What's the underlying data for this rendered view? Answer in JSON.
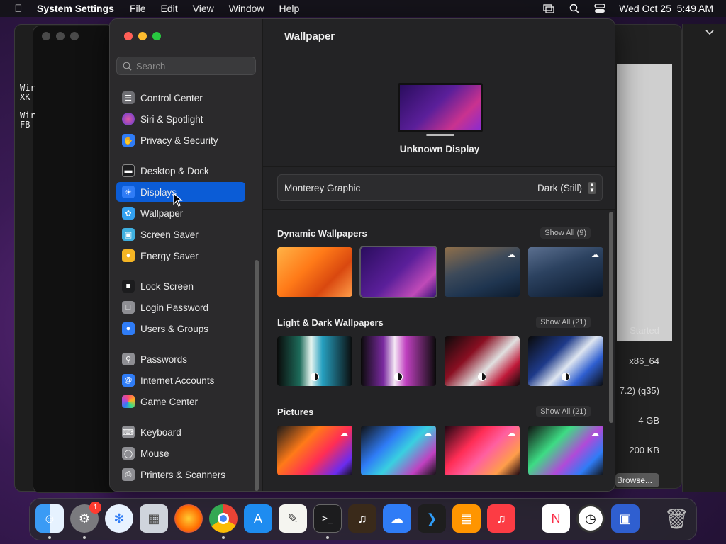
{
  "menubar": {
    "app_name": "System Settings",
    "menus": [
      "File",
      "Edit",
      "View",
      "Window",
      "Help"
    ],
    "clock": "Wed Oct 25  5:49 AM"
  },
  "background": {
    "terminal_text": "Wir\nXK\n\nWir\nFB",
    "right_values": [
      "Started",
      "x86_64",
      "7.2) (q35)",
      "4 GB",
      "200 KB"
    ],
    "browse_label": "Browse..."
  },
  "sidebar": {
    "search_placeholder": "Search",
    "items": [
      {
        "label": "Control Center",
        "icon": "control-center-icon",
        "color": "#6e6e73"
      },
      {
        "label": "Siri & Spotlight",
        "icon": "siri-icon",
        "color": "#b04ad8"
      },
      {
        "label": "Privacy & Security",
        "icon": "hand-icon",
        "color": "#2f7cf6"
      },
      {
        "label": "Desktop & Dock",
        "icon": "desktop-icon",
        "color": "#1c1c1e"
      },
      {
        "label": "Displays",
        "icon": "displays-icon",
        "color": "#2f7cf6"
      },
      {
        "label": "Wallpaper",
        "icon": "wallpaper-icon",
        "color": "#33a1f0"
      },
      {
        "label": "Screen Saver",
        "icon": "screen-saver-icon",
        "color": "#3fb0e0"
      },
      {
        "label": "Energy Saver",
        "icon": "energy-icon",
        "color": "#f5b524"
      },
      {
        "label": "Lock Screen",
        "icon": "lock-icon",
        "color": "#1c1c1e"
      },
      {
        "label": "Login Password",
        "icon": "login-password-icon",
        "color": "#8e8e93"
      },
      {
        "label": "Users & Groups",
        "icon": "users-icon",
        "color": "#2f7cf6"
      },
      {
        "label": "Passwords",
        "icon": "key-icon",
        "color": "#8e8e93"
      },
      {
        "label": "Internet Accounts",
        "icon": "at-icon",
        "color": "#2f7cf6"
      },
      {
        "label": "Game Center",
        "icon": "game-center-icon",
        "color": "#ffffff"
      },
      {
        "label": "Keyboard",
        "icon": "keyboard-icon",
        "color": "#8e8e93"
      },
      {
        "label": "Mouse",
        "icon": "mouse-icon",
        "color": "#8e8e93"
      },
      {
        "label": "Printers & Scanners",
        "icon": "printer-icon",
        "color": "#8e8e93"
      }
    ],
    "active": "Displays"
  },
  "content": {
    "title": "Wallpaper",
    "display_name": "Unknown Display",
    "wallpaper_name": "Monterey Graphic",
    "wallpaper_mode": "Dark (Still)",
    "sections": [
      {
        "title": "Dynamic Wallpapers",
        "show_all": "Show All (9)"
      },
      {
        "title": "Light & Dark Wallpapers",
        "show_all": "Show All (21)"
      },
      {
        "title": "Pictures",
        "show_all": "Show All (21)"
      }
    ]
  },
  "dock": {
    "apps": [
      "Finder",
      "System Settings",
      "Safari",
      "Launchpad",
      "Firefox",
      "Chrome",
      "App Store",
      "TextEdit",
      "Terminal",
      "GarageBand",
      "iCloud",
      "VS Code",
      "Books",
      "Music",
      "News",
      "Clock",
      "Screen Sharing",
      "Trash"
    ],
    "settings_badge": "1"
  }
}
